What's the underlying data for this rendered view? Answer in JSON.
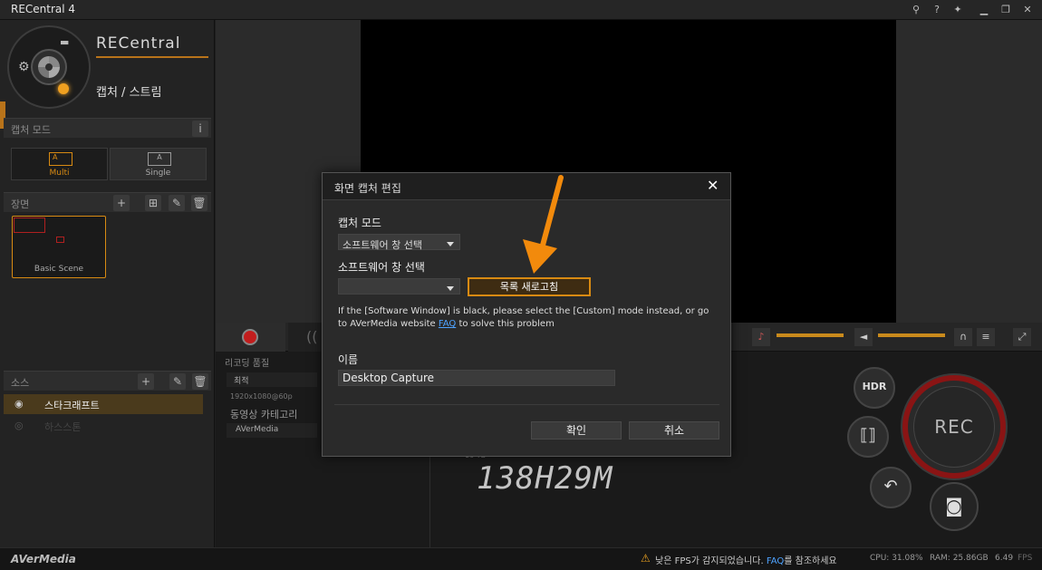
{
  "window": {
    "title": "RECentral 4"
  },
  "brand": {
    "logo_text": "RECentral",
    "mode_title": "캡처 / 스트림",
    "footer_logo": "AVerMedia"
  },
  "capture_mode": {
    "label": "캡처 모드",
    "info": "i",
    "options": [
      {
        "label": "Multi",
        "icon_letter": "A",
        "selected": true
      },
      {
        "label": "Single",
        "icon_letter": "A",
        "selected": false
      }
    ]
  },
  "scene": {
    "label": "장면",
    "items": [
      {
        "label": "Basic Scene"
      }
    ]
  },
  "source": {
    "label": "소스",
    "items": [
      {
        "label": "스타크래프트",
        "active": true
      },
      {
        "label": "하스스톤",
        "active": false
      }
    ]
  },
  "recording": {
    "quality_label": "리코딩 품질",
    "quality_value": "최적",
    "resolution": "1920x1080@60p",
    "category_label": "동영상 카테고리",
    "category_value": "AVerMedia",
    "timer": "138H29M",
    "timer_prefix": "10 TB"
  },
  "buttons": {
    "hdr": "HDR",
    "rec": "REC"
  },
  "dialog": {
    "title": "화면 캡처 편집",
    "capture_mode_label": "캡처 모드",
    "capture_mode_value": "소프트웨어 창 선택",
    "window_select_label": "소프트웨어 창 선택",
    "window_select_value": "",
    "refresh_button": "목록 새로고침",
    "help_text_1": "If the [Software Window] is black, please select the [Custom] mode instead, or go",
    "help_text_2a": "to AVerMedia website ",
    "help_link": "FAQ",
    "help_text_2b": " to solve this problem",
    "name_label": "이름",
    "name_value": "Desktop Capture",
    "ok_button": "확인",
    "cancel_button": "취소"
  },
  "status": {
    "warning_a": "낮은 FPS가 감지되었습니다. ",
    "warning_link": "FAQ",
    "warning_b": "를 참조하세요",
    "cpu": "CPU: 31.08%",
    "ram": "RAM: 25.86GB",
    "fps": "6.49",
    "fps_label": "FPS"
  },
  "colors": {
    "accent": "#d88a12",
    "rec_red": "#c21d1d",
    "link": "#4ea3ff",
    "arrow": "#f28a0c"
  }
}
